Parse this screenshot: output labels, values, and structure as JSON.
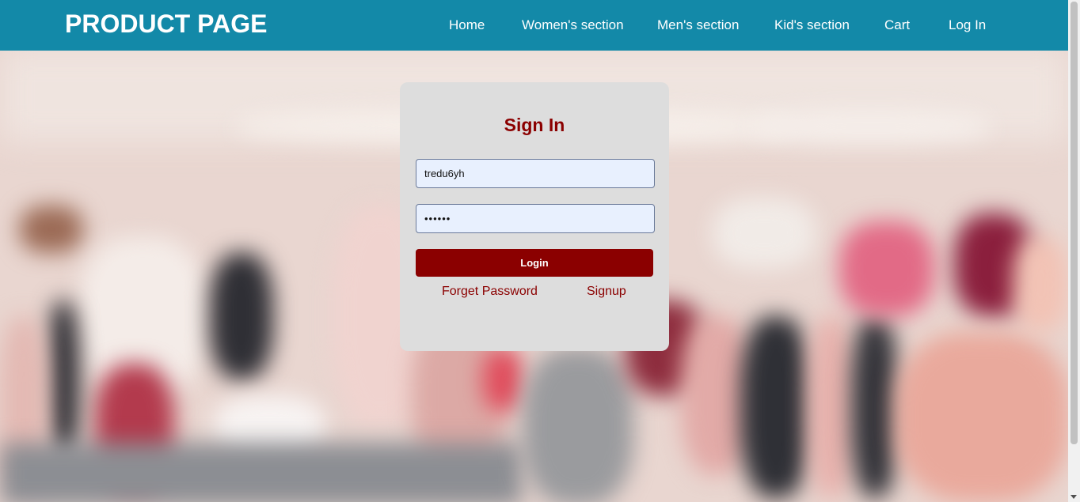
{
  "navbar": {
    "brand": "PRODUCT PAGE",
    "links": [
      "Home",
      "Women's section",
      "Men's section",
      "Kid's section",
      "Cart",
      "Log In"
    ]
  },
  "signin": {
    "title": "Sign In",
    "username_value": "tredu6yh",
    "password_value": "••••••",
    "login_label": "Login",
    "forget_label": "Forget Password",
    "signup_label": "Signup"
  },
  "colors": {
    "navbar": "#1389a8",
    "accent": "#8b0000",
    "card": "#dddddd",
    "input_bg": "#e8f0fe"
  }
}
